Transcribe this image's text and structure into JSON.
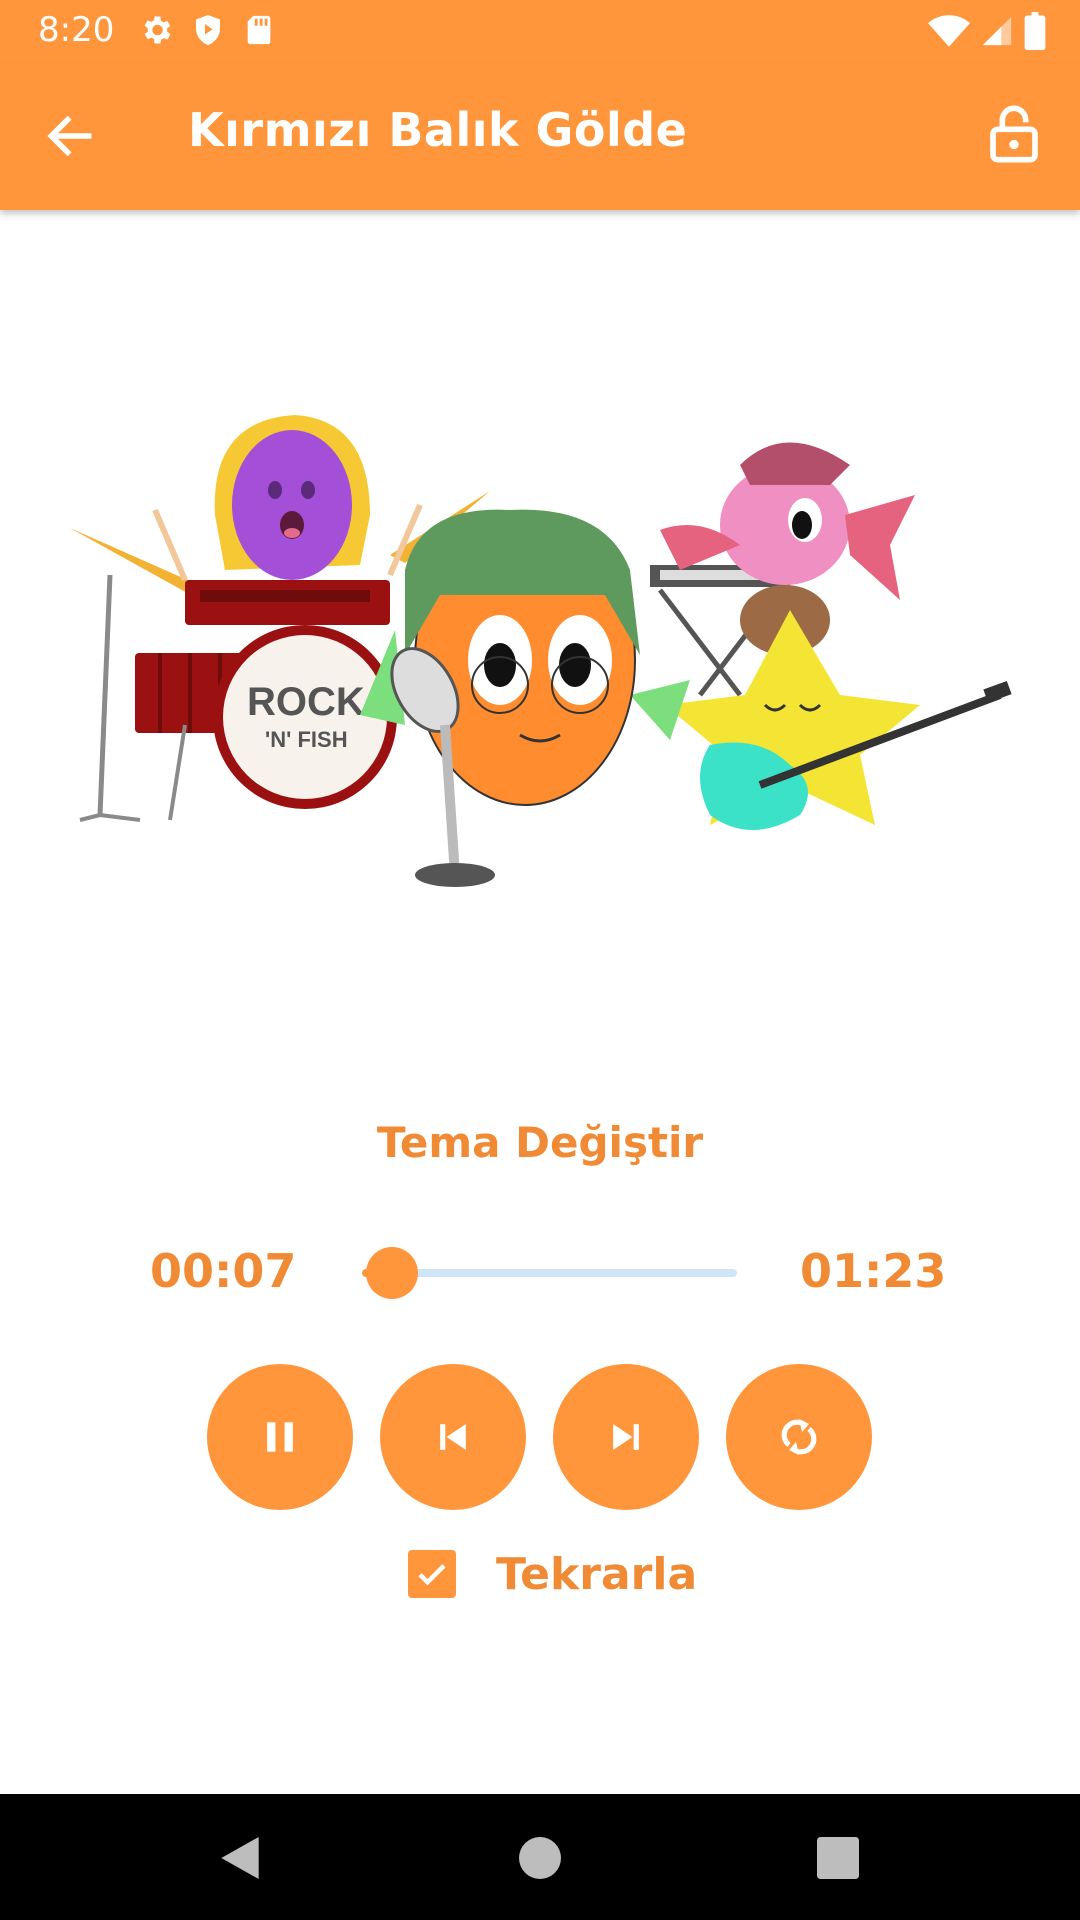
{
  "status_bar": {
    "time": "8:20",
    "icons_left": [
      "settings-icon",
      "shield-icon",
      "sd-card-icon"
    ],
    "icons_right": [
      "wifi-icon",
      "signal-icon",
      "battery-icon"
    ]
  },
  "app_bar": {
    "title": "Kırmızı Balık Gölde",
    "back_icon": "arrow-left-icon",
    "lock_icon": "lock-open-icon",
    "background": "#FF963C"
  },
  "illustration": {
    "drum_label_top": "ROCK",
    "drum_label_bottom": "'N' FISH"
  },
  "player": {
    "theme_button": "Tema Değiştir",
    "current_time": "00:07",
    "total_time": "01:23",
    "progress": 0.08,
    "controls": [
      "pause-icon",
      "skip-previous-icon",
      "skip-next-icon",
      "shuffle-icon"
    ],
    "repeat_label": "Tekrarla",
    "repeat_checked": true,
    "accent": "#FF963C",
    "text_color": "#F08A34",
    "track_color": "#CFE5F8"
  },
  "nav_bar": {
    "buttons": [
      "back-triangle-icon",
      "home-circle-icon",
      "recents-square-icon"
    ]
  }
}
